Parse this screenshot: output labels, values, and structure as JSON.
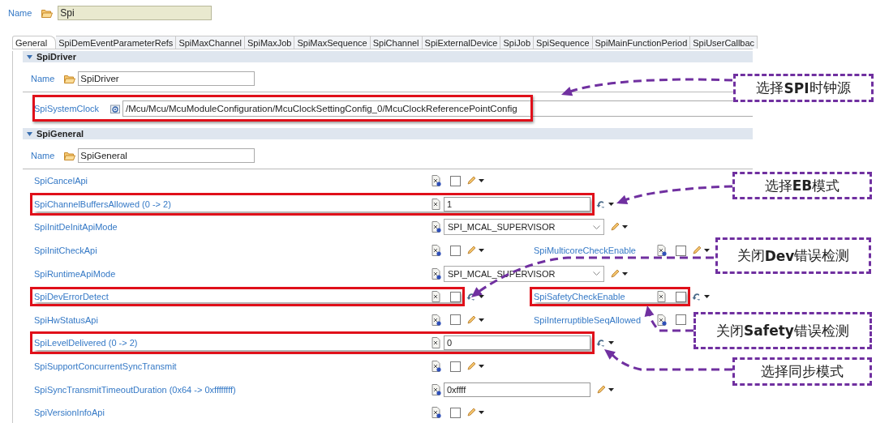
{
  "name_field": {
    "label": "Name",
    "value": "Spi"
  },
  "tabs": [
    {
      "label": "General",
      "selected": true
    },
    {
      "label": "SpiDemEventParameterRefs",
      "selected": false
    },
    {
      "label": "SpiMaxChannel",
      "selected": false
    },
    {
      "label": "SpiMaxJob",
      "selected": false
    },
    {
      "label": "SpiMaxSequence",
      "selected": false
    },
    {
      "label": "SpiChannel",
      "selected": false
    },
    {
      "label": "SpiExternalDevice",
      "selected": false
    },
    {
      "label": "SpiJob",
      "selected": false
    },
    {
      "label": "SpiSequence",
      "selected": false
    },
    {
      "label": "SpiMainFunctionPeriod",
      "selected": false
    },
    {
      "label": "SpiUserCallbac",
      "selected": false
    }
  ],
  "sections": [
    {
      "title": "SpiDriver",
      "expanded": true,
      "name_field": {
        "label": "Name",
        "value": "SpiDriver"
      },
      "reference": {
        "label": "SpiSystemClock",
        "value": "/Mcu/Mcu/McuModuleConfiguration/McuClockSettingConfig_0/McuClockReferencePointConfig",
        "highlighted": true
      }
    },
    {
      "title": "SpiGeneral",
      "expanded": true,
      "name_field": {
        "label": "Name",
        "value": "SpiGeneral"
      },
      "params": [
        {
          "label": "SpiCancelApi",
          "kind": "checkbox",
          "checked": false,
          "calculated": false,
          "highlighted": false
        },
        {
          "label": "SpiChannelBuffersAllowed (0 -> 2)",
          "kind": "text",
          "value": "1",
          "calculated": true,
          "highlighted": true
        },
        {
          "label": "SpiInitDeInitApiMode",
          "kind": "select",
          "value": "SPI_MCAL_SUPERVISOR",
          "calculated": false,
          "highlighted": false
        },
        {
          "label": "SpiInitCheckApi",
          "kind": "checkbox",
          "checked": false,
          "calculated": false,
          "highlighted": false,
          "side": {
            "label": "SpiMulticoreCheckEnable",
            "kind": "checkbox",
            "checked": false,
            "calculated": false,
            "highlighted": false
          }
        },
        {
          "label": "SpiRuntimeApiMode",
          "kind": "select",
          "value": "SPI_MCAL_SUPERVISOR",
          "calculated": false,
          "highlighted": false
        },
        {
          "label": "SpiDevErrorDetect",
          "kind": "checkbox",
          "checked": false,
          "calculated": true,
          "highlighted": true,
          "side": {
            "label": "SpiSafetyCheckEnable",
            "kind": "checkbox",
            "checked": false,
            "calculated": true,
            "highlighted": true
          }
        },
        {
          "label": "SpiHwStatusApi",
          "kind": "checkbox",
          "checked": false,
          "calculated": false,
          "highlighted": false,
          "side": {
            "label": "SpiInterruptibleSeqAllowed",
            "kind": "checkbox",
            "checked": false,
            "highlighted": false
          }
        },
        {
          "label": "SpiLevelDelivered (0 -> 2)",
          "kind": "text",
          "value": "0",
          "calculated": true,
          "highlighted": true
        },
        {
          "label": "SpiSupportConcurrentSyncTransmit",
          "kind": "checkbox",
          "checked": false,
          "calculated": false,
          "highlighted": false
        },
        {
          "label": "SpiSyncTransmitTimeoutDuration (0x64 -> 0xffffffff)",
          "kind": "text",
          "value": "0xffff",
          "calculated": false,
          "highlighted": false
        },
        {
          "label": "SpiVersionInfoApi",
          "kind": "checkbox",
          "checked": false,
          "calculated": false,
          "highlighted": false
        }
      ]
    }
  ],
  "callouts": [
    {
      "text": "选择**SPI**时钟源"
    },
    {
      "text": "选择**EB**模式"
    },
    {
      "text": "关闭**Dev**错误检测"
    },
    {
      "text": "关闭**Safety**错误检测"
    },
    {
      "text": "选择同步模式"
    }
  ]
}
